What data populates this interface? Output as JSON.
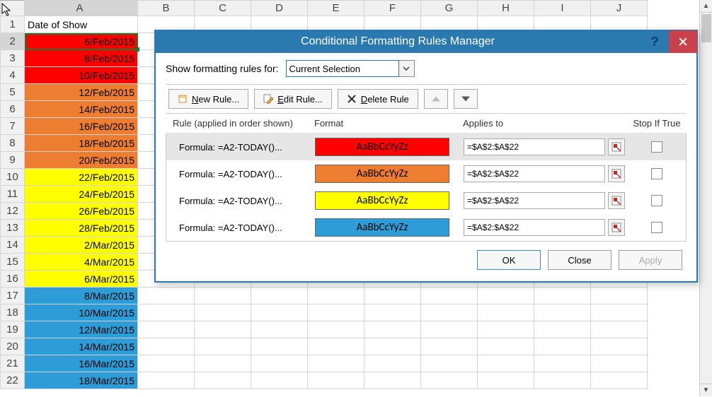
{
  "columns": {
    "rownum": "",
    "letters": [
      "A",
      "B",
      "C",
      "D",
      "E",
      "F",
      "G",
      "H",
      "I",
      "J"
    ]
  },
  "header_cell": "Date of Show",
  "rows": [
    {
      "n": 1,
      "val": "Date of Show",
      "color": ""
    },
    {
      "n": 2,
      "val": "6/Feb/2015",
      "color": "red",
      "active": true
    },
    {
      "n": 3,
      "val": "8/Feb/2015",
      "color": "red"
    },
    {
      "n": 4,
      "val": "10/Feb/2015",
      "color": "red"
    },
    {
      "n": 5,
      "val": "12/Feb/2015",
      "color": "orange"
    },
    {
      "n": 6,
      "val": "14/Feb/2015",
      "color": "orange"
    },
    {
      "n": 7,
      "val": "16/Feb/2015",
      "color": "orange"
    },
    {
      "n": 8,
      "val": "18/Feb/2015",
      "color": "orange"
    },
    {
      "n": 9,
      "val": "20/Feb/2015",
      "color": "orange"
    },
    {
      "n": 10,
      "val": "22/Feb/2015",
      "color": "yellow"
    },
    {
      "n": 11,
      "val": "24/Feb/2015",
      "color": "yellow"
    },
    {
      "n": 12,
      "val": "26/Feb/2015",
      "color": "yellow"
    },
    {
      "n": 13,
      "val": "28/Feb/2015",
      "color": "yellow"
    },
    {
      "n": 14,
      "val": "2/Mar/2015",
      "color": "yellow"
    },
    {
      "n": 15,
      "val": "4/Mar/2015",
      "color": "yellow"
    },
    {
      "n": 16,
      "val": "6/Mar/2015",
      "color": "yellow"
    },
    {
      "n": 17,
      "val": "8/Mar/2015",
      "color": "blue"
    },
    {
      "n": 18,
      "val": "10/Mar/2015",
      "color": "blue"
    },
    {
      "n": 19,
      "val": "12/Mar/2015",
      "color": "blue"
    },
    {
      "n": 20,
      "val": "14/Mar/2015",
      "color": "blue"
    },
    {
      "n": 21,
      "val": "16/Mar/2015",
      "color": "blue"
    },
    {
      "n": 22,
      "val": "18/Mar/2015",
      "color": "blue"
    }
  ],
  "dialog": {
    "title": "Conditional Formatting Rules Manager",
    "show_rules_label": "Show formatting rules for:",
    "show_rules_value": "Current Selection",
    "buttons": {
      "new": "New Rule...",
      "edit": "Edit Rule...",
      "delete": "Delete Rule"
    },
    "headers": {
      "rule": "Rule (applied in order shown)",
      "format": "Format",
      "applies": "Applies to",
      "stop": "Stop If True"
    },
    "preview_text": "AaBbCcYyZz",
    "rules": [
      {
        "formula": "Formula: =A2-TODAY()...",
        "color": "red",
        "applies": "=$A$2:$A$22",
        "selected": true
      },
      {
        "formula": "Formula: =A2-TODAY()...",
        "color": "orange",
        "applies": "=$A$2:$A$22"
      },
      {
        "formula": "Formula: =A2-TODAY()...",
        "color": "yellow",
        "applies": "=$A$2:$A$22"
      },
      {
        "formula": "Formula: =A2-TODAY()...",
        "color": "blue",
        "applies": "=$A$2:$A$22"
      }
    ],
    "footer": {
      "ok": "OK",
      "close": "Close",
      "apply": "Apply"
    }
  }
}
